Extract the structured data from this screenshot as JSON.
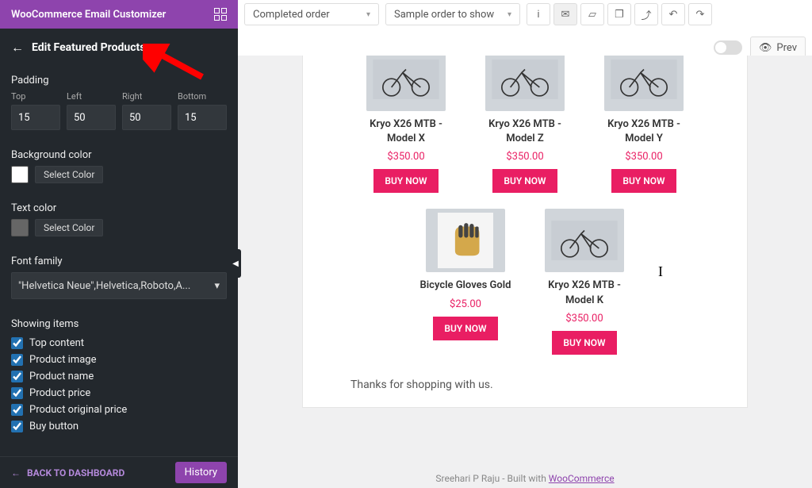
{
  "brand": "WooCommerce Email Customizer",
  "toolbar": {
    "dropdown1": "Completed order",
    "dropdown2": "Sample order to show",
    "preview": "Prev"
  },
  "sidebar": {
    "title": "Edit Featured Products",
    "padding": {
      "label": "Padding",
      "top": {
        "label": "Top",
        "value": "15"
      },
      "left": {
        "label": "Left",
        "value": "50"
      },
      "right": {
        "label": "Right",
        "value": "50"
      },
      "bottom": {
        "label": "Bottom",
        "value": "15"
      }
    },
    "bg_label": "Background color",
    "textcolor_label": "Text color",
    "select_color": "Select Color",
    "font_label": "Font family",
    "font_value": "\"Helvetica Neue\",Helvetica,Roboto,A...",
    "showing_label": "Showing items",
    "items": [
      {
        "label": "Top content",
        "checked": true
      },
      {
        "label": "Product image",
        "checked": true
      },
      {
        "label": "Product name",
        "checked": true
      },
      {
        "label": "Product price",
        "checked": true
      },
      {
        "label": "Product original price",
        "checked": true
      },
      {
        "label": "Buy button",
        "checked": true
      }
    ],
    "back_dash": "BACK TO DASHBOARD",
    "history": "History"
  },
  "products": [
    {
      "name": "Kryo X26 MTB - Model X",
      "price": "$350.00",
      "buy": "BUY NOW",
      "img": "bike"
    },
    {
      "name": "Kryo X26 MTB - Model Z",
      "price": "$350.00",
      "buy": "BUY NOW",
      "img": "bike"
    },
    {
      "name": "Kryo X26 MTB - Model Y",
      "price": "$350.00",
      "buy": "BUY NOW",
      "img": "bike"
    },
    {
      "name": "Bicycle Gloves Gold",
      "price": "$25.00",
      "buy": "BUY NOW",
      "img": "glove"
    },
    {
      "name": "Kryo X26 MTB - Model K",
      "price": "$350.00",
      "buy": "BUY NOW",
      "img": "bike"
    }
  ],
  "thanks": "Thanks for shopping with us.",
  "footer": {
    "author": "Sreehari P Raju",
    "built": " - Built with ",
    "link": "WooCommerce"
  }
}
